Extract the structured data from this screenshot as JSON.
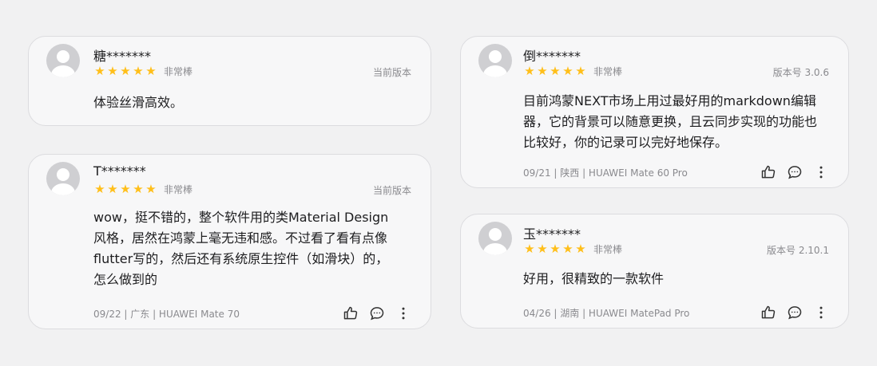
{
  "theme": {
    "star_color": "#ffbf1a",
    "card_bg": "#f7f7f8",
    "page_bg": "#f1f1f2"
  },
  "reviews": [
    {
      "user": "糖*******",
      "stars": 5,
      "rating_label": "非常棒",
      "version": "当前版本",
      "text": "体验丝滑高效。",
      "meta": "",
      "actions": []
    },
    {
      "user": "T*******",
      "stars": 5,
      "rating_label": "非常棒",
      "version": "当前版本",
      "text": "wow，挺不错的，整个软件用的类Material Design风格，居然在鸿蒙上毫无违和感。不过看了看有点像flutter写的，然后还有系统原生控件（如滑块）的，怎么做到的",
      "meta": "09/22 | 广东 | HUAWEI Mate 70",
      "actions": [
        "thumbs-up-icon",
        "comment-icon",
        "more-vertical-icon"
      ]
    },
    {
      "user": "倒*******",
      "stars": 5,
      "rating_label": "非常棒",
      "version": "版本号 3.0.6",
      "text": "目前鸿蒙NEXT市场上用过最好用的markdown编辑器，它的背景可以随意更换，且云同步实现的功能也比较好，你的记录可以完好地保存。",
      "meta": "09/21 | 陕西 | HUAWEI Mate 60 Pro",
      "actions": [
        "thumbs-up-icon",
        "comment-icon",
        "more-vertical-icon"
      ]
    },
    {
      "user": "玉*******",
      "stars": 5,
      "rating_label": "非常棒",
      "version": "版本号 2.10.1",
      "text": "好用，很精致的一款软件",
      "meta": "04/26 | 湖南 | HUAWEI MatePad Pro",
      "actions": [
        "thumbs-up-icon",
        "comment-icon",
        "more-vertical-icon"
      ]
    }
  ]
}
